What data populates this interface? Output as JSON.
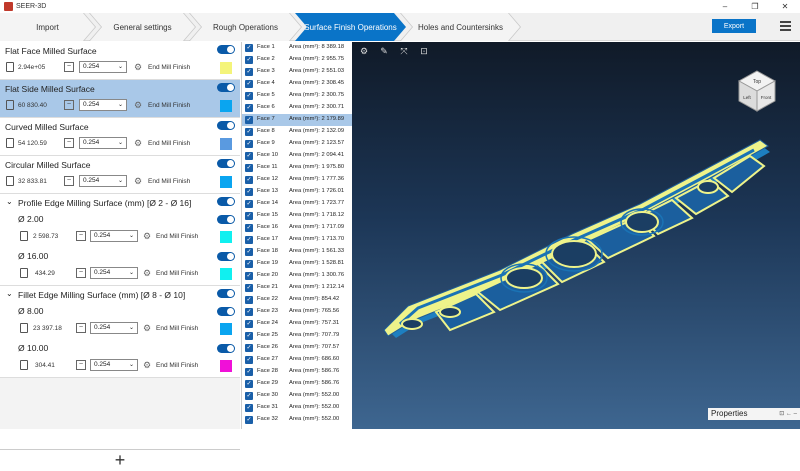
{
  "window": {
    "title": "SEER-3D",
    "min": "–",
    "max": "❐",
    "close": "✕"
  },
  "tabs": [
    {
      "label": "Import"
    },
    {
      "label": "General settings"
    },
    {
      "label": "Rough Operations"
    },
    {
      "label": "Surface Finish Operations"
    },
    {
      "label": "Holes and Countersinks"
    }
  ],
  "export_label": "Export",
  "operations": [
    {
      "title": "Flat Face Milled Surface",
      "value": "2.94e+05",
      "stepover": "0.254",
      "tool": "End Mill Finish",
      "color": "#f4f47a",
      "selected": false
    },
    {
      "title": "Flat Side Milled Surface",
      "value": "60 830.40",
      "stepover": "0.254",
      "tool": "End Mill Finish",
      "color": "#0aa5f0",
      "selected": true
    },
    {
      "title": "Curved Milled Surface",
      "value": "54 120.59",
      "stepover": "0.254",
      "tool": "End Mill Finish",
      "color": "#5a9ae0",
      "selected": false
    },
    {
      "title": "Circular Milled Surface",
      "value": "32 833.81",
      "stepover": "0.254",
      "tool": "End Mill Finish",
      "color": "#0aa5f0",
      "selected": false
    }
  ],
  "groups": [
    {
      "title": "Profile Edge Milling Surface (mm) [Ø 2 - Ø 16]",
      "subs": [
        {
          "title": "Ø 2.00",
          "value": "2 598.73",
          "stepover": "0.254",
          "tool": "End Mill Finish",
          "color": "#10f0f0"
        },
        {
          "title": "Ø 16.00",
          "value": "434.29",
          "stepover": "0.254",
          "tool": "End Mill Finish",
          "color": "#10f0f0"
        }
      ]
    },
    {
      "title": "Fillet Edge Milling Surface (mm) [Ø 8 - Ø 10]",
      "subs": [
        {
          "title": "Ø 8.00",
          "value": "23 397.18",
          "stepover": "0.254",
          "tool": "End Mill Finish",
          "color": "#0aa5f0"
        },
        {
          "title": "Ø 10.00",
          "value": "304.41",
          "stepover": "0.254",
          "tool": "End Mill Finish",
          "color": "#f010d8"
        }
      ]
    }
  ],
  "add_label": "+",
  "faces": [
    {
      "name": "Face 1",
      "area": "Area (mm²): 8 389.18"
    },
    {
      "name": "Face 2",
      "area": "Area (mm²): 2 955.75"
    },
    {
      "name": "Face 3",
      "area": "Area (mm²): 2 551.03"
    },
    {
      "name": "Face 4",
      "area": "Area (mm²): 2 308.45"
    },
    {
      "name": "Face 5",
      "area": "Area (mm²): 2 300.75"
    },
    {
      "name": "Face 6",
      "area": "Area (mm²): 2 300.71"
    },
    {
      "name": "Face 7",
      "area": "Area (mm²): 2 179.89"
    },
    {
      "name": "Face 8",
      "area": "Area (mm²): 2 132.09"
    },
    {
      "name": "Face 9",
      "area": "Area (mm²): 2 123.57"
    },
    {
      "name": "Face 10",
      "area": "Area (mm²): 2 094.41"
    },
    {
      "name": "Face 11",
      "area": "Area (mm²): 1 975.80"
    },
    {
      "name": "Face 12",
      "area": "Area (mm²): 1 777.36"
    },
    {
      "name": "Face 13",
      "area": "Area (mm²): 1 726.01"
    },
    {
      "name": "Face 14",
      "area": "Area (mm²): 1 723.77"
    },
    {
      "name": "Face 15",
      "area": "Area (mm²): 1 718.12"
    },
    {
      "name": "Face 16",
      "area": "Area (mm²): 1 717.09"
    },
    {
      "name": "Face 17",
      "area": "Area (mm²): 1 713.70"
    },
    {
      "name": "Face 18",
      "area": "Area (mm²): 1 561.33"
    },
    {
      "name": "Face 19",
      "area": "Area (mm²): 1 528.81"
    },
    {
      "name": "Face 20",
      "area": "Area (mm²): 1 300.76"
    },
    {
      "name": "Face 21",
      "area": "Area (mm²): 1 212.14"
    },
    {
      "name": "Face 22",
      "area": "Area (mm²): 854.42"
    },
    {
      "name": "Face 23",
      "area": "Area (mm²): 765.56"
    },
    {
      "name": "Face 24",
      "area": "Area (mm²): 757.31"
    },
    {
      "name": "Face 25",
      "area": "Area (mm²): 707.79"
    },
    {
      "name": "Face 26",
      "area": "Area (mm²): 707.57"
    },
    {
      "name": "Face 27",
      "area": "Area (mm²): 686.60"
    },
    {
      "name": "Face 28",
      "area": "Area (mm²): 586.76"
    },
    {
      "name": "Face 29",
      "area": "Area (mm²): 586.76"
    },
    {
      "name": "Face 30",
      "area": "Area (mm²): 552.00"
    },
    {
      "name": "Face 31",
      "area": "Area (mm²): 552.00"
    },
    {
      "name": "Face 32",
      "area": "Area (mm²): 552.00"
    }
  ],
  "selected_face": "Face 7",
  "cube": {
    "top": "Top",
    "left": "Left",
    "front": "Front"
  },
  "properties": {
    "label": "Properties",
    "buttons": "⊡ ← –"
  }
}
